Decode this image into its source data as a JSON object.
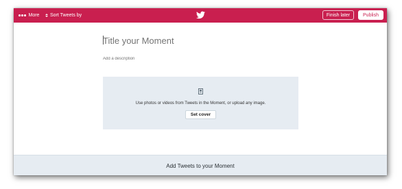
{
  "topbar": {
    "more_label": "More",
    "sort_label": "Sort Tweets by",
    "finish_label": "Finish later",
    "publish_label": "Publish",
    "logo_icon": "twitter-bird-icon",
    "background_color": "#c91f4f"
  },
  "editor": {
    "title_placeholder": "Title your Moment",
    "description_placeholder": "Add a description"
  },
  "cover": {
    "icon": "image-icon",
    "instruction": "Use photos or videos from Tweets in the Moment, or upload any image.",
    "button_label": "Set cover"
  },
  "footer": {
    "add_tweets_label": "Add Tweets to your Moment"
  }
}
